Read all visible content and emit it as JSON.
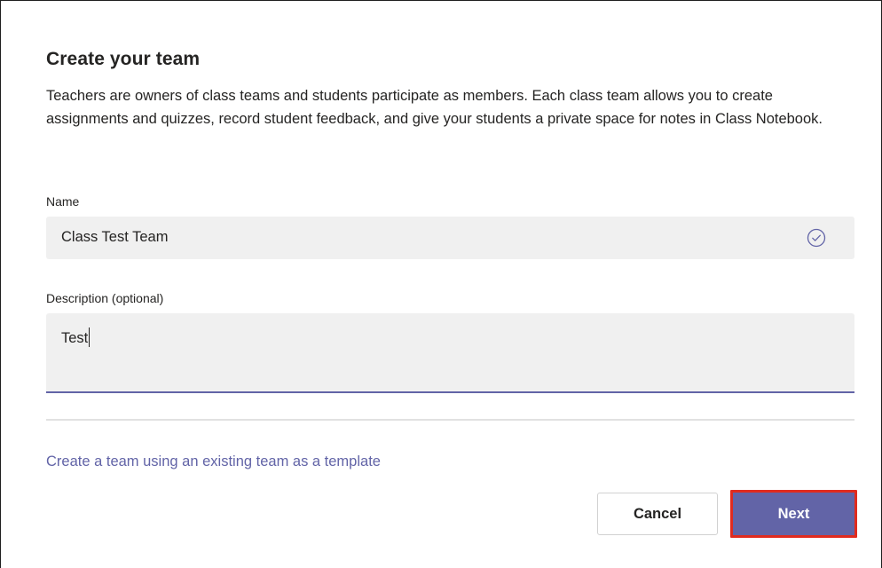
{
  "dialog": {
    "title": "Create your team",
    "intro": "Teachers are owners of class teams and students participate as members. Each class team allows you to create assignments and quizzes, record student feedback, and give your students a private space for notes in Class Notebook."
  },
  "name_field": {
    "label": "Name",
    "value": "Class Test Team",
    "status_icon": "check-circle-icon"
  },
  "description_field": {
    "label": "Description (optional)",
    "value": "Test"
  },
  "template_link": "Create a team using an existing team as a template",
  "buttons": {
    "cancel": "Cancel",
    "next": "Next"
  },
  "colors": {
    "accent": "#6264a7",
    "highlight_border": "#e02b1f",
    "field_bg": "#f0f0f0"
  }
}
